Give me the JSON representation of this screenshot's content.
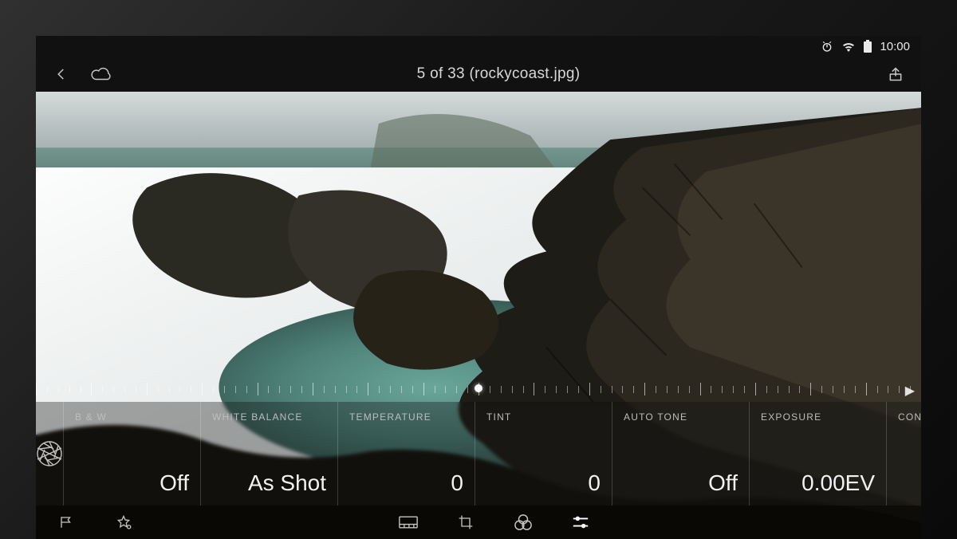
{
  "status": {
    "time": "10:00"
  },
  "header": {
    "title": "5 of 33 (rockycoast.jpg)"
  },
  "adjust": {
    "items": [
      {
        "label": "B & W",
        "value": "Off"
      },
      {
        "label": "WHITE BALANCE",
        "value": "As Shot"
      },
      {
        "label": "TEMPERATURE",
        "value": "0"
      },
      {
        "label": "TINT",
        "value": "0"
      },
      {
        "label": "AUTO TONE",
        "value": "Off"
      },
      {
        "label": "EXPOSURE",
        "value": "0.00EV"
      },
      {
        "label": "CONTRAST",
        "value": ""
      }
    ]
  }
}
